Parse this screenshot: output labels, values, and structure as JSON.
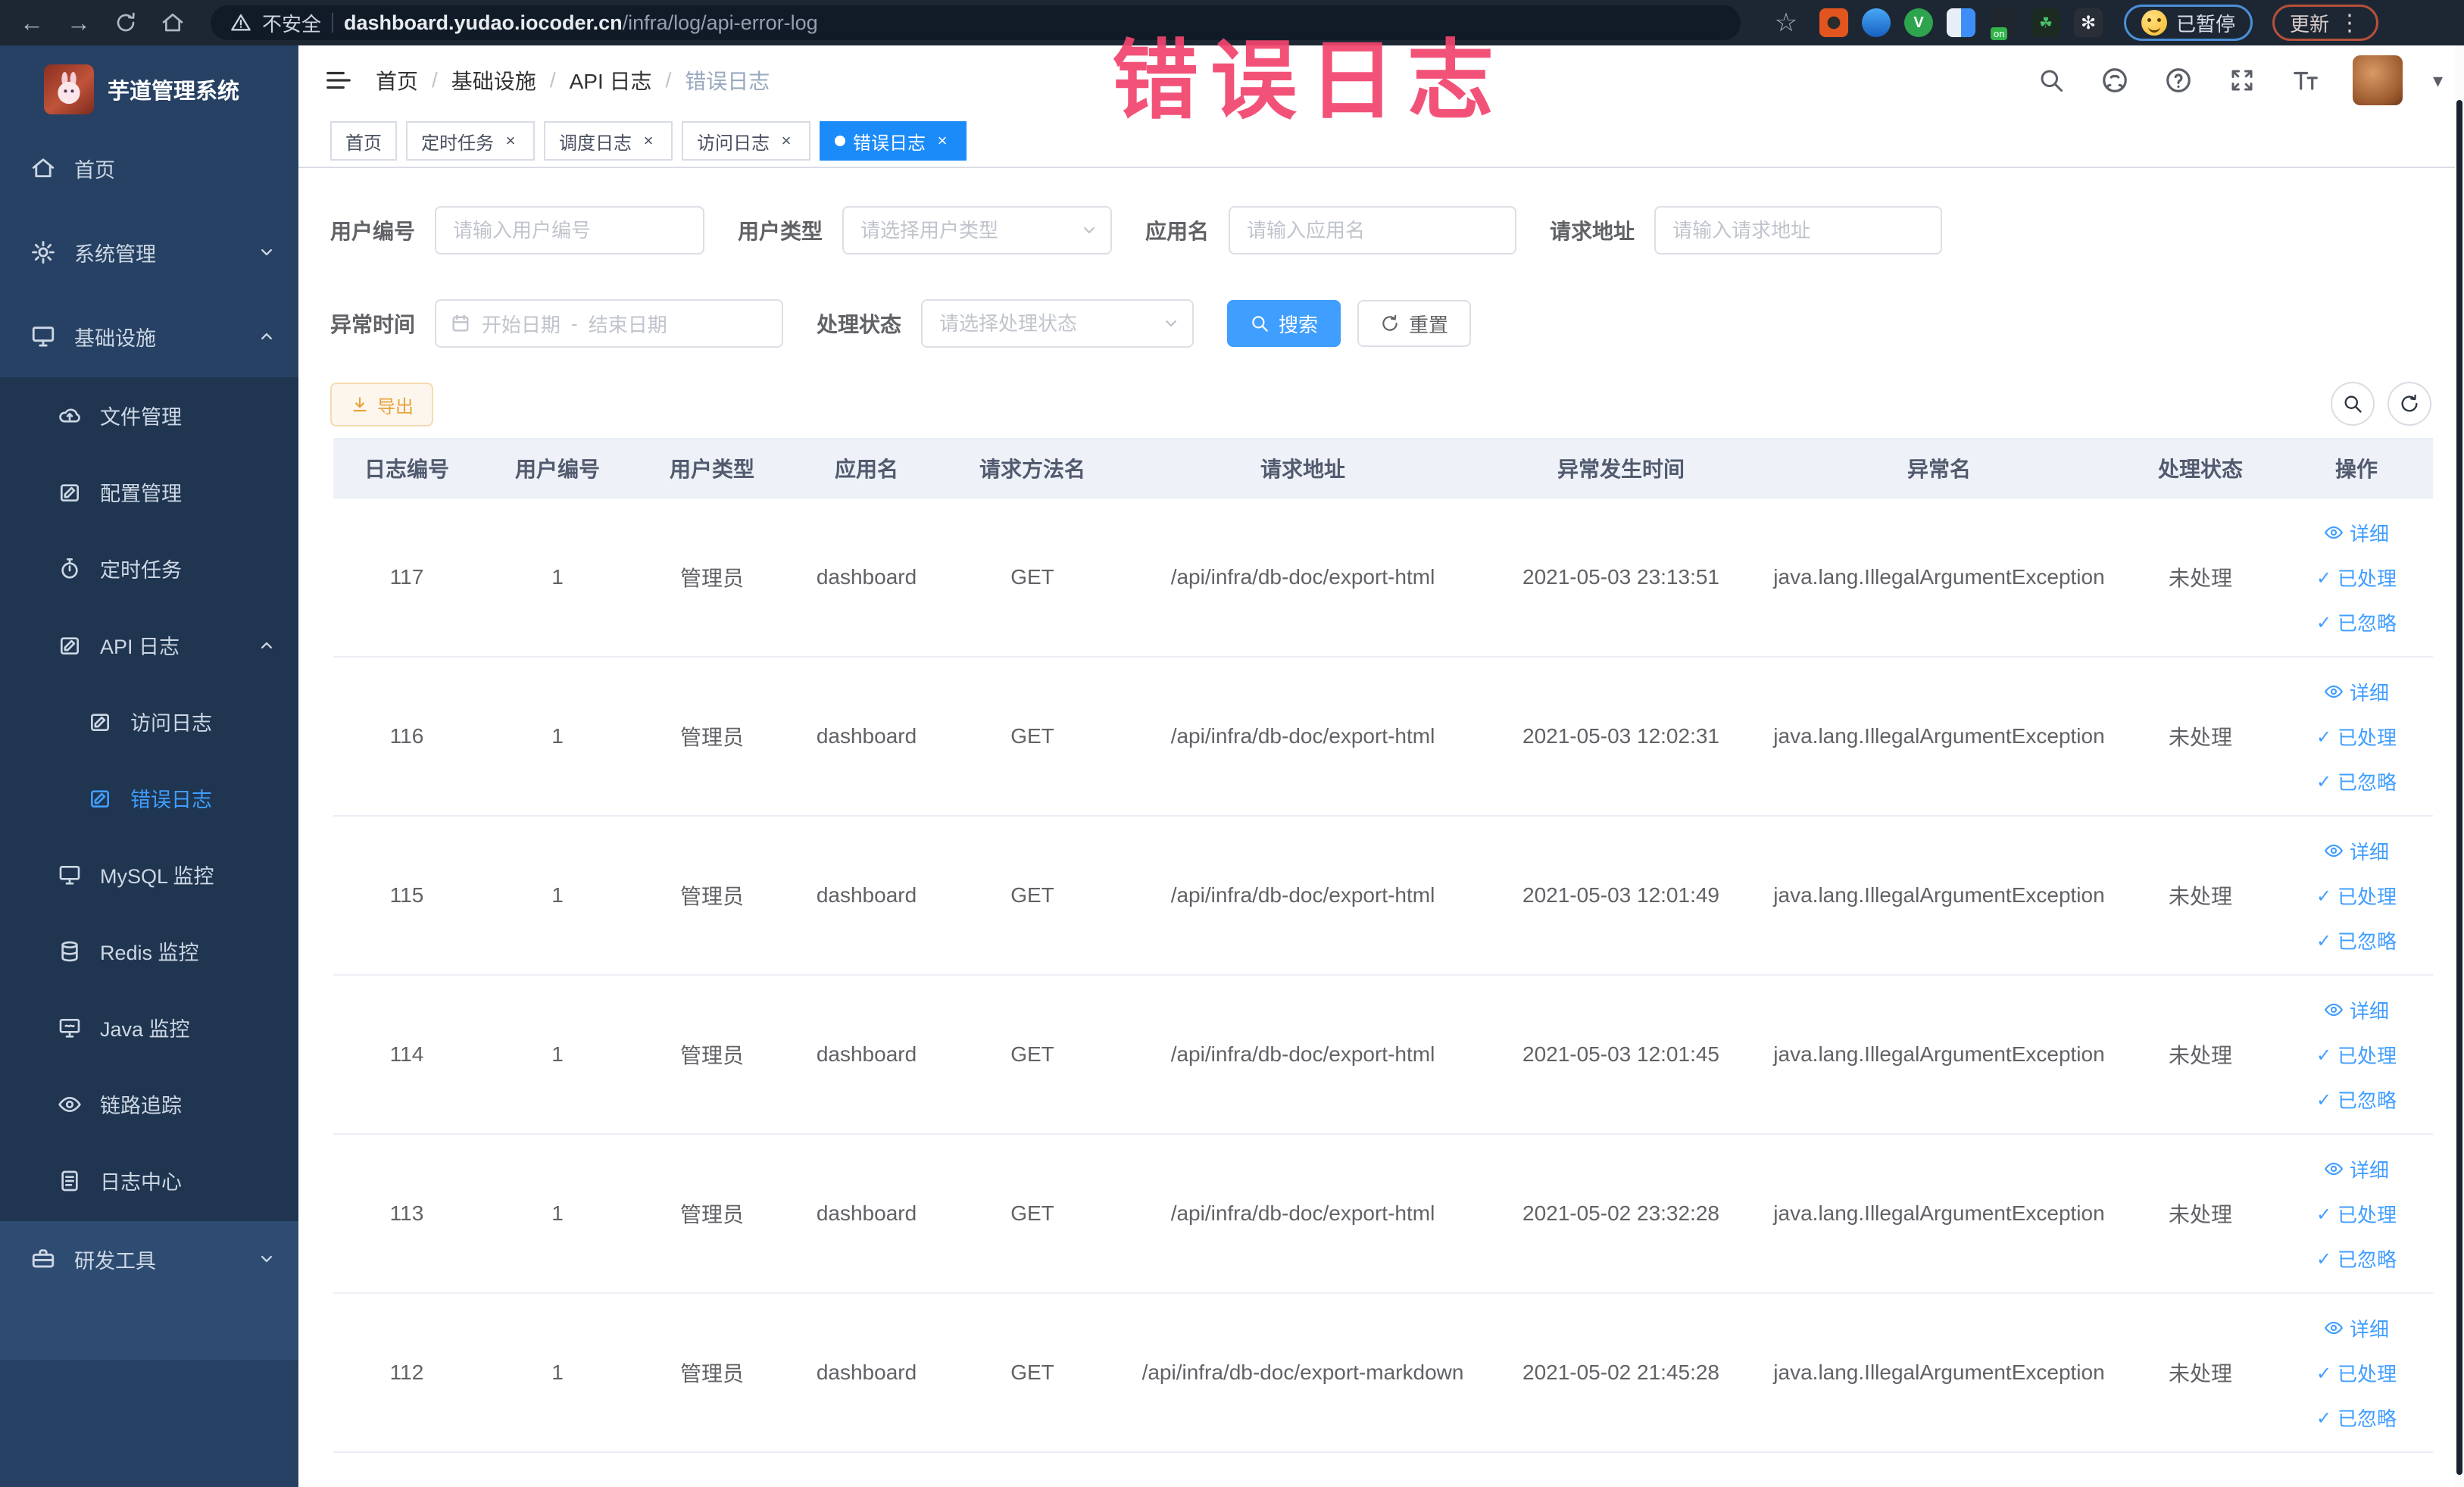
{
  "colors": {
    "accent": "#409eff",
    "active_tab": "#1b8bfa",
    "annotation_pink": "#f2436c",
    "sidebar_bg": "#264163",
    "submenu_bg": "#1f3550",
    "warning_text": "#e6a23c"
  },
  "browser": {
    "security": "不安全",
    "url_host": "dashboard.yudao.iocoder.cn",
    "url_path": "/infra/log/api-error-log",
    "paused_badge": "已暂停",
    "update_button": "更新"
  },
  "annotation": "错误日志",
  "sidebar": {
    "title": "芋道管理系统",
    "home": "首页",
    "system": "系统管理",
    "infra": "基础设施",
    "file": "文件管理",
    "config": "配置管理",
    "job": "定时任务",
    "apilog": "API 日志",
    "accesslog": "访问日志",
    "errorlog": "错误日志",
    "mysql": "MySQL 监控",
    "redis": "Redis 监控",
    "java": "Java 监控",
    "trace": "链路追踪",
    "logcenter": "日志中心",
    "devtools": "研发工具"
  },
  "breadcrumb": [
    "首页",
    "基础设施",
    "API 日志",
    "错误日志"
  ],
  "breadcrumb_sep": "/",
  "tabs": [
    "首页",
    "定时任务",
    "调度日志",
    "访问日志",
    "错误日志"
  ],
  "filters": {
    "user_id": {
      "label": "用户编号",
      "placeholder": "请输入用户编号"
    },
    "user_type": {
      "label": "用户类型",
      "placeholder": "请选择用户类型"
    },
    "app_name": {
      "label": "应用名",
      "placeholder": "请输入应用名"
    },
    "request_url": {
      "label": "请求地址",
      "placeholder": "请输入请求地址"
    },
    "exception_time": {
      "label": "异常时间",
      "start_placeholder": "开始日期",
      "separator": "-",
      "end_placeholder": "结束日期"
    },
    "process_status": {
      "label": "处理状态",
      "placeholder": "请选择处理状态"
    },
    "search_button": "搜索",
    "reset_button": "重置"
  },
  "toolbar": {
    "export": "导出"
  },
  "table": {
    "headers": [
      "日志编号",
      "用户编号",
      "用户类型",
      "应用名",
      "请求方法名",
      "请求地址",
      "异常发生时间",
      "异常名",
      "处理状态",
      "操作"
    ],
    "rows": [
      {
        "id": "117",
        "user_id": "1",
        "user_type": "管理员",
        "app": "dashboard",
        "method": "GET",
        "url": "/api/infra/db-doc/export-html",
        "time": "2021-05-03 23:13:51",
        "exception": "java.lang.IllegalArgumentException",
        "status": "未处理"
      },
      {
        "id": "116",
        "user_id": "1",
        "user_type": "管理员",
        "app": "dashboard",
        "method": "GET",
        "url": "/api/infra/db-doc/export-html",
        "time": "2021-05-03 12:02:31",
        "exception": "java.lang.IllegalArgumentException",
        "status": "未处理"
      },
      {
        "id": "115",
        "user_id": "1",
        "user_type": "管理员",
        "app": "dashboard",
        "method": "GET",
        "url": "/api/infra/db-doc/export-html",
        "time": "2021-05-03 12:01:49",
        "exception": "java.lang.IllegalArgumentException",
        "status": "未处理"
      },
      {
        "id": "114",
        "user_id": "1",
        "user_type": "管理员",
        "app": "dashboard",
        "method": "GET",
        "url": "/api/infra/db-doc/export-html",
        "time": "2021-05-03 12:01:45",
        "exception": "java.lang.IllegalArgumentException",
        "status": "未处理"
      },
      {
        "id": "113",
        "user_id": "1",
        "user_type": "管理员",
        "app": "dashboard",
        "method": "GET",
        "url": "/api/infra/db-doc/export-html",
        "time": "2021-05-02 23:32:28",
        "exception": "java.lang.IllegalArgumentException",
        "status": "未处理"
      },
      {
        "id": "112",
        "user_id": "1",
        "user_type": "管理员",
        "app": "dashboard",
        "method": "GET",
        "url": "/api/infra/db-doc/export-markdown",
        "time": "2021-05-02 21:45:28",
        "exception": "java.lang.IllegalArgumentException",
        "status": "未处理"
      }
    ]
  },
  "actions": {
    "detail": "详细",
    "processed": "已处理",
    "ignored": "已忽略"
  }
}
